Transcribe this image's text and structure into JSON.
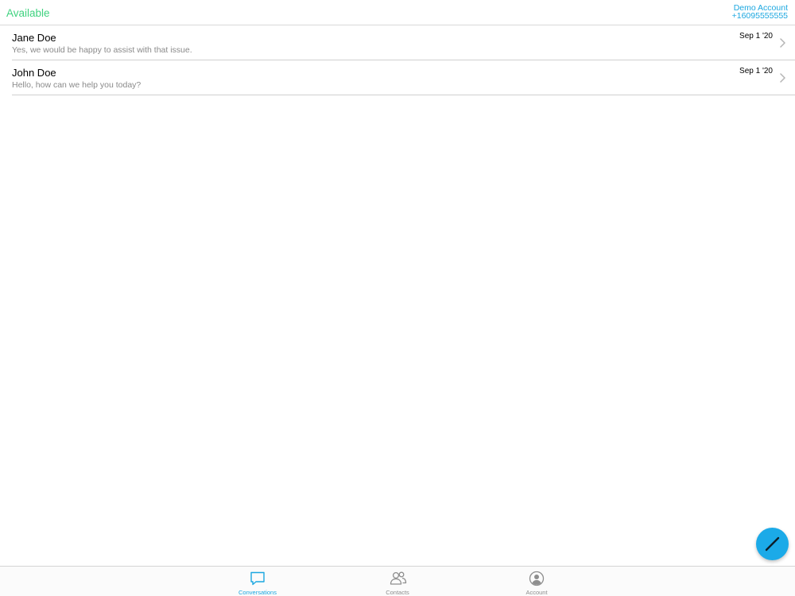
{
  "header": {
    "status": "Available",
    "account_name": "Demo Account",
    "account_number": "+16095555555"
  },
  "conversations": [
    {
      "name": "Jane Doe",
      "preview": "Yes, we would be happy to assist with that issue.",
      "date": "Sep 1 '20"
    },
    {
      "name": "John Doe",
      "preview": "Hello, how can we help you today?",
      "date": "Sep 1 '20"
    }
  ],
  "fab": {
    "icon": "compose-pencil-icon"
  },
  "tabs": [
    {
      "label": "Conversations",
      "icon": "chat-bubble-icon",
      "active": true
    },
    {
      "label": "Contacts",
      "icon": "people-icon",
      "active": false
    },
    {
      "label": "Account",
      "icon": "user-circle-icon",
      "active": false
    }
  ],
  "colors": {
    "status": "#3fd27f",
    "accent": "#1ba7e0",
    "fab": "#1baae8",
    "inactive_tab": "#8e8e8e"
  }
}
